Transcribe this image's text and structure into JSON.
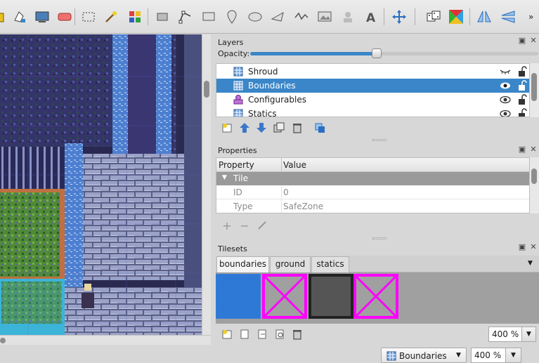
{
  "toolbar": {
    "tools": [
      {
        "name": "bucket-fill-icon"
      },
      {
        "name": "stamp-fill-icon"
      },
      {
        "name": "screen-icon"
      },
      {
        "name": "eraser-icon"
      },
      {
        "name": "rect-select-icon"
      },
      {
        "name": "magic-wand-icon"
      },
      {
        "name": "select-same-tile-icon"
      },
      {
        "name": "select-objects-icon"
      },
      {
        "name": "edit-polygons-icon"
      },
      {
        "name": "insert-rectangle-icon"
      },
      {
        "name": "insert-point-icon"
      },
      {
        "name": "insert-ellipse-icon"
      },
      {
        "name": "insert-polygon-icon"
      },
      {
        "name": "insert-polyline-icon"
      },
      {
        "name": "insert-tile-icon"
      },
      {
        "name": "insert-template-icon"
      },
      {
        "name": "insert-text-icon"
      },
      {
        "name": "move-icon"
      },
      {
        "name": "random-mode-icon"
      },
      {
        "name": "wang-fill-icon"
      },
      {
        "name": "flip-horizontal-icon"
      },
      {
        "name": "flip-vertical-icon"
      }
    ],
    "overflow": "»"
  },
  "layers": {
    "title": "Layers",
    "opacity_label": "Opacity:",
    "opacity": 0.44,
    "items": [
      {
        "label": "Shroud",
        "visible": false,
        "type": "tile-layer"
      },
      {
        "label": "Boundaries",
        "visible": true,
        "type": "tile-layer",
        "selected": true
      },
      {
        "label": "Configurables",
        "visible": true,
        "type": "object-layer"
      },
      {
        "label": "Statics",
        "visible": true,
        "type": "tile-layer"
      }
    ]
  },
  "properties": {
    "title": "Properties",
    "headers": [
      "Property",
      "Value"
    ],
    "group": "Tile",
    "rows": [
      {
        "key": "ID",
        "value": "0"
      },
      {
        "key": "Type",
        "value": "SafeZone"
      }
    ]
  },
  "tilesets": {
    "title": "Tilesets",
    "tabs": [
      "boundaries",
      "ground",
      "statics"
    ],
    "active_tab": "boundaries",
    "zoom": "400 %"
  },
  "status": {
    "current_layer": "Boundaries",
    "zoom": "400 %"
  },
  "colors": {
    "selection": "#3a86c8",
    "tile_blue": "#2f79d6",
    "tile_magenta": "#ff00ff",
    "tile_gray": "#555555"
  }
}
